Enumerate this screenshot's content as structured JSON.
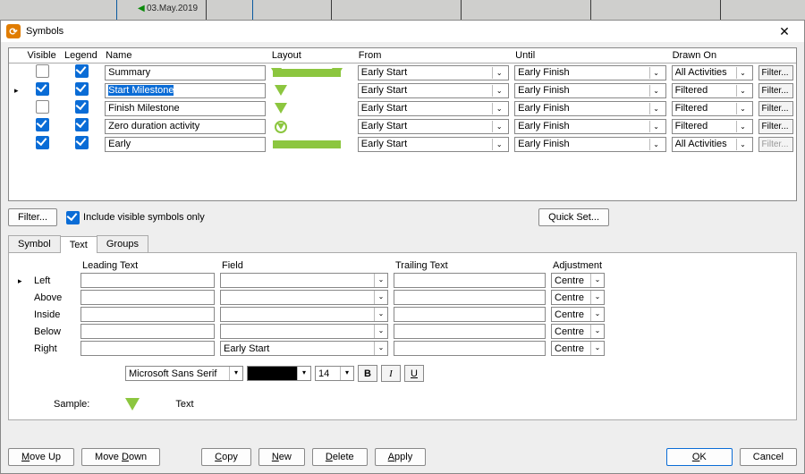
{
  "ruler": {
    "date": "03.May.2019",
    "arrow_icon": "left-arrow-icon"
  },
  "window": {
    "title": "Symbols",
    "grid": {
      "headers": [
        "Visible",
        "Legend",
        "Name",
        "Layout",
        "From",
        "Until",
        "Drawn On",
        ""
      ],
      "filter_label": "Filter...",
      "rows": [
        {
          "ptr": false,
          "visible": false,
          "legend": true,
          "name": "Summary",
          "layout": "summary",
          "from": "Early Start",
          "until": "Early Finish",
          "drawn": "All Activities",
          "filter_disabled": false
        },
        {
          "ptr": true,
          "visible": true,
          "legend": true,
          "name": "Start Milestone",
          "selected": true,
          "layout": "tri",
          "from": "Early Start",
          "until": "Early Finish",
          "drawn": "Filtered",
          "filter_disabled": false
        },
        {
          "ptr": false,
          "visible": false,
          "legend": true,
          "name": "Finish Milestone",
          "layout": "tri",
          "from": "Early Start",
          "until": "Early Finish",
          "drawn": "Filtered",
          "filter_disabled": false
        },
        {
          "ptr": false,
          "visible": true,
          "legend": true,
          "name": "Zero duration activity",
          "layout": "diamond",
          "from": "Early Start",
          "until": "Early Finish",
          "drawn": "Filtered",
          "filter_disabled": false
        },
        {
          "ptr": false,
          "visible": true,
          "legend": true,
          "name": "Early",
          "layout": "bar",
          "from": "Early Start",
          "until": "Early Finish",
          "drawn": "All Activities",
          "filter_disabled": true
        }
      ]
    },
    "strip": {
      "filter_btn": "Filter...",
      "include": "Include visible symbols only",
      "quick_set": "Quick Set..."
    },
    "tabs": [
      "Symbol",
      "Text",
      "Groups"
    ],
    "active_tab": 1,
    "text_panel": {
      "col_headers": [
        "Leading Text",
        "Field",
        "Trailing Text",
        "Adjustment"
      ],
      "rows": [
        {
          "label": "Left",
          "field": "",
          "adj": "Centre"
        },
        {
          "label": "Above",
          "field": "",
          "adj": "Centre"
        },
        {
          "label": "Inside",
          "field": "",
          "adj": "Centre"
        },
        {
          "label": "Below",
          "field": "",
          "adj": "Centre"
        },
        {
          "label": "Right",
          "field": "Early Start",
          "adj": "Centre"
        }
      ],
      "font": {
        "name": "Microsoft Sans Serif",
        "size": "14"
      },
      "format_btns": {
        "bold": "B",
        "italic": "I",
        "underline": "U"
      },
      "sample_label": "Sample:",
      "sample_text": "Text"
    },
    "buttons": {
      "move_up": "Move Up",
      "move_down": "Move Down",
      "copy": "Copy",
      "new": "New",
      "delete": "Delete",
      "apply": "Apply",
      "ok": "OK",
      "cancel": "Cancel"
    }
  }
}
